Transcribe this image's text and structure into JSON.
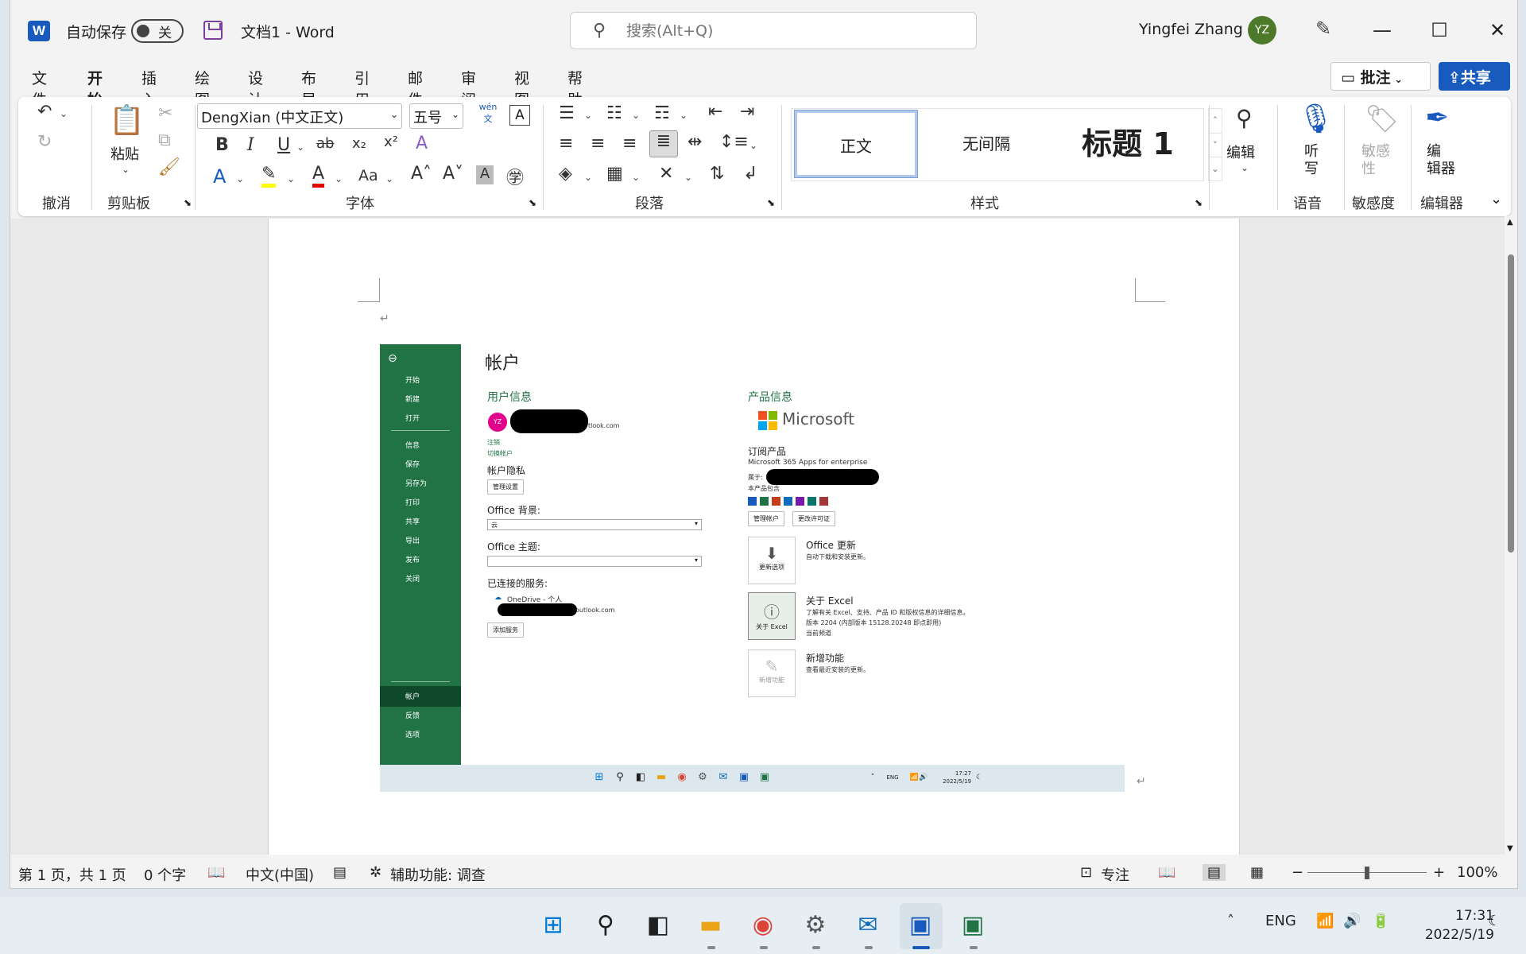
{
  "titlebar": {
    "app_logo": "W",
    "autosave_label": "自动保存",
    "autosave_state": "关",
    "doc_name": "文档1  -  Word",
    "search_placeholder": "搜索(Alt+Q)",
    "user_name": "Yingfei Zhang",
    "user_initials": "YZ"
  },
  "tabs": [
    "文件",
    "开始",
    "插入",
    "绘图",
    "设计",
    "布局",
    "引用",
    "邮件",
    "审阅",
    "视图",
    "帮助"
  ],
  "active_tab": "开始",
  "actions": {
    "comment": "批注",
    "share": "共享"
  },
  "ribbon": {
    "groups": {
      "undo": "撤消",
      "clipboard": "剪贴板",
      "font": "字体",
      "paragraph": "段落",
      "styles": "样式",
      "editing_group": "编辑",
      "voice": "语音",
      "sensitivity": "敏感度",
      "editor": "编辑器"
    },
    "paste_label": "粘贴",
    "font_name": "DengXian (中文正文)",
    "font_size": "五号",
    "phonetic_top": "wén",
    "phonetic_bottom": "文",
    "styles": [
      "正文",
      "无间隔",
      "标题 1"
    ],
    "editing_label": "编辑",
    "dictate_label": "听\n写",
    "sensitivity_label": "敏感\n性",
    "editor_label": "编\n辑器"
  },
  "document": {
    "screenshot": {
      "title": "帐户",
      "sidebar_items": [
        "开始",
        "新建",
        "打开",
        "信息",
        "保存",
        "另存为",
        "打印",
        "共享",
        "导出",
        "发布",
        "关闭",
        "帐户",
        "反馈",
        "选项"
      ],
      "user_info_head": "用户信息",
      "email_suffix": "tlook.com",
      "sign_out": "注销",
      "switch_account": "切换帐户",
      "privacy_head": "帐户隐私",
      "manage_settings": "管理设置",
      "background_head": "Office 背景:",
      "background_value": "云",
      "theme_head": "Office 主题:",
      "theme_value": "",
      "connected_head": "已连接的服务:",
      "onedrive": "OneDrive - 个人",
      "onedrive_email_suffix": "outlook.com",
      "add_service": "添加服务",
      "product_head": "产品信息",
      "microsoft": "Microsoft",
      "subscription_head": "订阅产品",
      "subscription_name": "Microsoft 365 Apps for enterprise",
      "owner_label": "属于:",
      "product_contains": "本产品包含",
      "manage_account": "管理帐户",
      "change_license": "更改许可证",
      "update_tile": "更新选项",
      "update_title": "Office 更新",
      "update_desc": "自动下载和安装更新。",
      "about_tile": "关于 Excel",
      "about_title": "关于 Excel",
      "about_desc1": "了解有关 Excel、支持、产品 ID 和版权信息的详细信息。",
      "about_desc2": "版本 2204 (内部版本 15128.20248 即点即用)",
      "about_desc3": "当前频道",
      "new_tile": "新增功能",
      "new_title": "新增功能",
      "new_desc": "查看最近安装的更新。",
      "taskbar_lang": "ENG",
      "taskbar_time": "17:27",
      "taskbar_date": "2022/5/19"
    }
  },
  "statusbar": {
    "page": "第 1 页，共 1 页",
    "words": "0 个字",
    "language": "中文(中国)",
    "accessibility": "辅助功能: 调查",
    "focus": "专注",
    "zoom": "100%",
    "zoom_level": 1.0
  },
  "taskbar": {
    "lang": "ENG",
    "time": "17:31",
    "date": "2022/5/19"
  },
  "colors": {
    "word_blue": "#185abd",
    "excel_green": "#217346",
    "avatar_green": "#4d7a2a"
  }
}
